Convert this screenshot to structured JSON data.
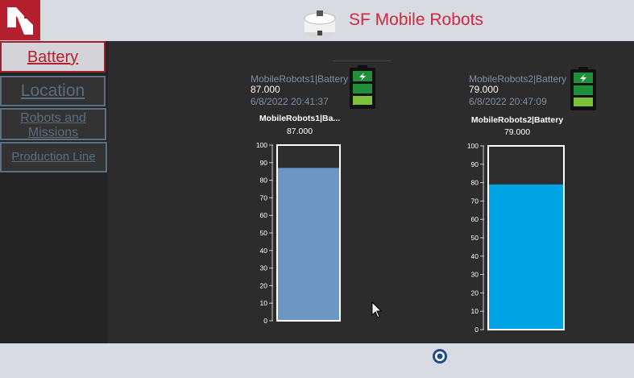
{
  "app": {
    "title": "SF Mobile Robots"
  },
  "nav": [
    {
      "label": "Battery",
      "active": true
    },
    {
      "label": "Location",
      "active": false
    },
    {
      "label": "Robots and Missions",
      "active": false
    },
    {
      "label": "Production Line",
      "active": false
    }
  ],
  "robots": [
    {
      "name": "MobileRobots1|Battery",
      "value": "87.000",
      "timestamp": "6/8/2022 20:41:37",
      "gauge_title": "MobileRobots1|Ba...",
      "gauge_value": "87.000",
      "level": 87,
      "fill_color": "#6e96c5"
    },
    {
      "name": "MobileRobots2|Battery",
      "value": "79.000",
      "timestamp": "6/8/2022 20:47:09",
      "gauge_title": "MobileRobots2|Battery",
      "gauge_value": "79.000",
      "level": 79,
      "fill_color": "#00a3e4"
    }
  ],
  "gauge_scale": {
    "min": 0,
    "max": 100,
    "ticks": [
      0,
      10,
      20,
      30,
      40,
      50,
      60,
      70,
      80,
      90,
      100
    ]
  },
  "colors": {
    "accent": "#d2273f",
    "brand_red": "#b5202e",
    "battery_green": "#22a33d"
  },
  "footer": {
    "logo_icon": "company-globe-logo"
  }
}
